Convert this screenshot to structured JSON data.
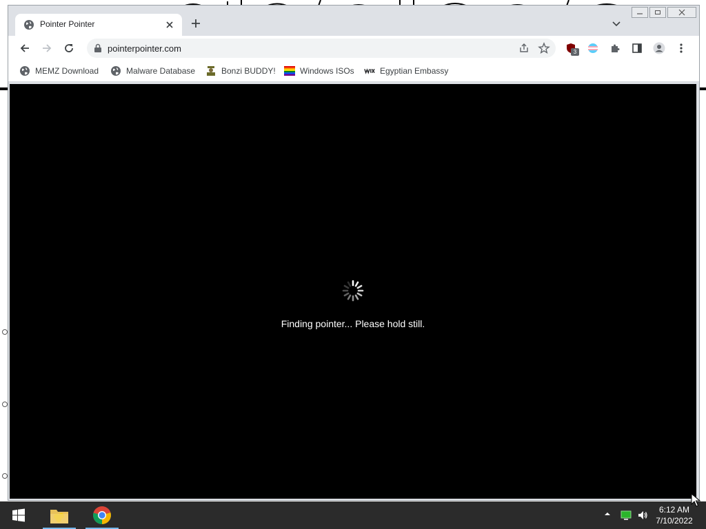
{
  "browser": {
    "tab": {
      "title": "Pointer Pointer"
    },
    "address_bar": {
      "url": "pointerpointer.com"
    },
    "extensions": {
      "ublock_count": "3"
    },
    "bookmarks": [
      {
        "label": "MEMZ Download",
        "icon": "globe-icon"
      },
      {
        "label": "Malware Database",
        "icon": "globe-icon"
      },
      {
        "label": "Bonzi BUDDY!",
        "icon": "bonzi-icon"
      },
      {
        "label": "Windows ISOs",
        "icon": "rainbow-flag-icon"
      },
      {
        "label": "Egyptian Embassy",
        "icon": "wix-icon"
      }
    ]
  },
  "page": {
    "status_message": "Finding pointer... Please hold still."
  },
  "taskbar": {
    "clock_time": "6:12 AM",
    "clock_date": "7/10/2022"
  },
  "colors": {
    "page_background": "#000000",
    "taskbar": "#2b2b2b",
    "chrome_frame": "#dee1e6"
  }
}
